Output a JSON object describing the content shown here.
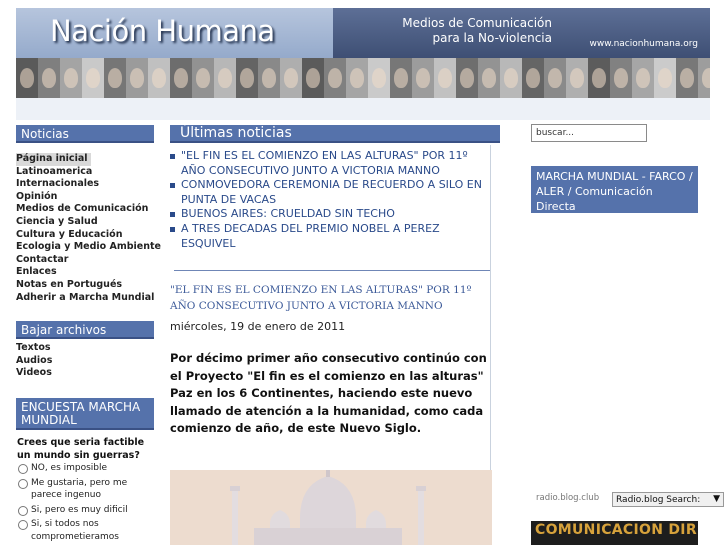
{
  "header": {
    "title": "Nación Humana",
    "slogan_line1": "Medios de Comunicación",
    "slogan_line2": "para la No-violencia",
    "url": "www.nacionhumana.org"
  },
  "sidebar": {
    "menu_title": "Noticias",
    "menu_items": [
      "Página inicial",
      "Latinoamerica",
      "Internacionales",
      "Opinión",
      "Medios de Comunicación",
      "Ciencia y Salud",
      "Cultura y Educación",
      "Ecologia y Medio Ambiente",
      "Contactar",
      "Enlaces",
      "Notas en Portugués",
      "Adherir a Marcha Mundial"
    ],
    "downloads_title": "Bajar archivos",
    "download_items": [
      "Textos",
      "Audios",
      "Videos"
    ],
    "poll_title": "ENCUESTA MARCHA MUNDIAL",
    "poll_question": "Crees que seria factible un mundo sin guerras?",
    "poll_options": [
      "NO, es imposible",
      "Me gustaria, pero me parece ingenuo",
      "Si, pero es muy dificil",
      "Si, si todos nos comprometieramos"
    ]
  },
  "main": {
    "section_title": "Últimas noticias",
    "headlines": [
      "\"EL FIN ES EL COMIENZO EN LAS ALTURAS\" POR 11º AÑO CONSECUTIVO JUNTO A VICTORIA MANNO",
      "CONMOVEDORA CEREMONIA DE RECUERDO A SILO EN PUNTA DE VACAS",
      "BUENOS AIRES: CRUELDAD SIN TECHO",
      "A TRES DECADAS DEL PREMIO NOBEL A PEREZ ESQUIVEL"
    ],
    "article": {
      "title": "\"EL FIN ES EL COMIENZO EN LAS ALTURAS\" POR 11º AÑO CONSECUTIVO JUNTO A VICTORIA MANNO",
      "date": "miércoles, 19 de enero de 2011",
      "body": "Por décimo primer año consecutivo continúo con el Proyecto \"El fin es el comienzo en las alturas\" Paz en los 6 Continentes, haciendo este nuevo llamado de atención a la humanidad, como cada comienzo de año, de este Nuevo Siglo."
    }
  },
  "right": {
    "search_placeholder": "buscar...",
    "banner_text": "MARCHA MUNDIAL - FARCO / ALER / Comunicación Directa",
    "radio_label": "radio.blog.club",
    "radio_select": "Radio.blog Search:",
    "bottom_banner": "COMUNICACION DIRECTA"
  },
  "colors": {
    "accent": "#5572ab",
    "link": "#2a4a8a",
    "header_dark": "#3e4f74"
  },
  "icons": {
    "headline_bullet": "square-bullet-icon",
    "select_arrow": "chevron-down-icon"
  }
}
